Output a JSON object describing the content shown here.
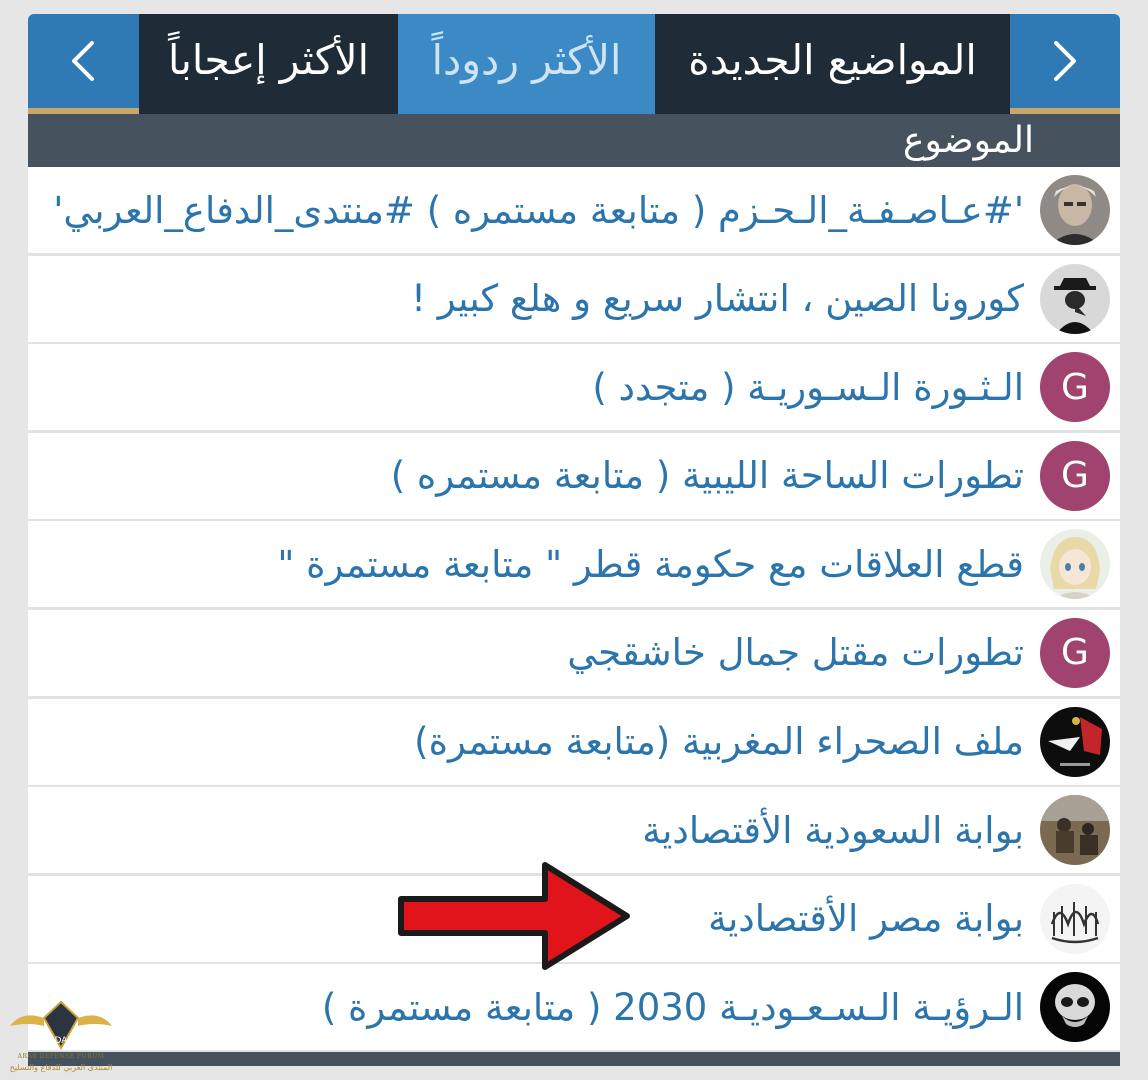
{
  "tabs": [
    {
      "label": "المواضيع الجديدة",
      "active": false
    },
    {
      "label": "الأكثر ردوداً",
      "active": true
    },
    {
      "label": "الأكثر إعجاباً",
      "active": false
    }
  ],
  "nav": {
    "prev_icon": "chevron-right-icon",
    "next_icon": "chevron-left-icon"
  },
  "table": {
    "column_header": "الموضوع",
    "rows": [
      {
        "title": "'#عـاصـفـة_الـحـزم ( متابعة مستمره ) #منتدى_الدفاع_العربي'",
        "avatar": "photo"
      },
      {
        "title": "كورونا الصين ، انتشار سريع و هلع كبير !",
        "avatar": "photo"
      },
      {
        "title": "الـثـورة الـسـوريـة ( متجدد )",
        "avatar": "letter",
        "avatar_letter": "G"
      },
      {
        "title": "تطورات الساحة الليبية ( متابعة مستمره )",
        "avatar": "letter",
        "avatar_letter": "G"
      },
      {
        "title": "قطع العلاقات مع حكومة قطر \" متابعة مستمرة \"",
        "avatar": "photo"
      },
      {
        "title": "تطورات مقتل جمال خاشقجي",
        "avatar": "letter",
        "avatar_letter": "G"
      },
      {
        "title": "ملف الصحراء المغربية (متابعة مستمرة)",
        "avatar": "photo"
      },
      {
        "title": "بوابة السعودية الأقتصادية",
        "avatar": "photo"
      },
      {
        "title": "بوابة مصر الأقتصادية",
        "avatar": "calligraphy"
      },
      {
        "title": "الـرؤيـة الـسـعـوديـة 2030 ( متابعة مستمرة )",
        "avatar": "photo"
      }
    ]
  },
  "annotation": {
    "type": "red-arrow",
    "points_to": "بوابة مصر الأقتصادية"
  },
  "watermark": {
    "line1": "ARAB DEFENSE FORUM",
    "line2": "المنتدى العربي للدفاع والتسليح",
    "logo_text": "DA"
  },
  "colors": {
    "tab_bar": "#2f79b5",
    "tab_dark": "#1f2b37",
    "tab_active": "#3b8ac6",
    "accent_gold": "#c9a66b",
    "header_bg": "#46525d",
    "link": "#2b74ac",
    "avatar_letter_bg": "#a0436e"
  }
}
